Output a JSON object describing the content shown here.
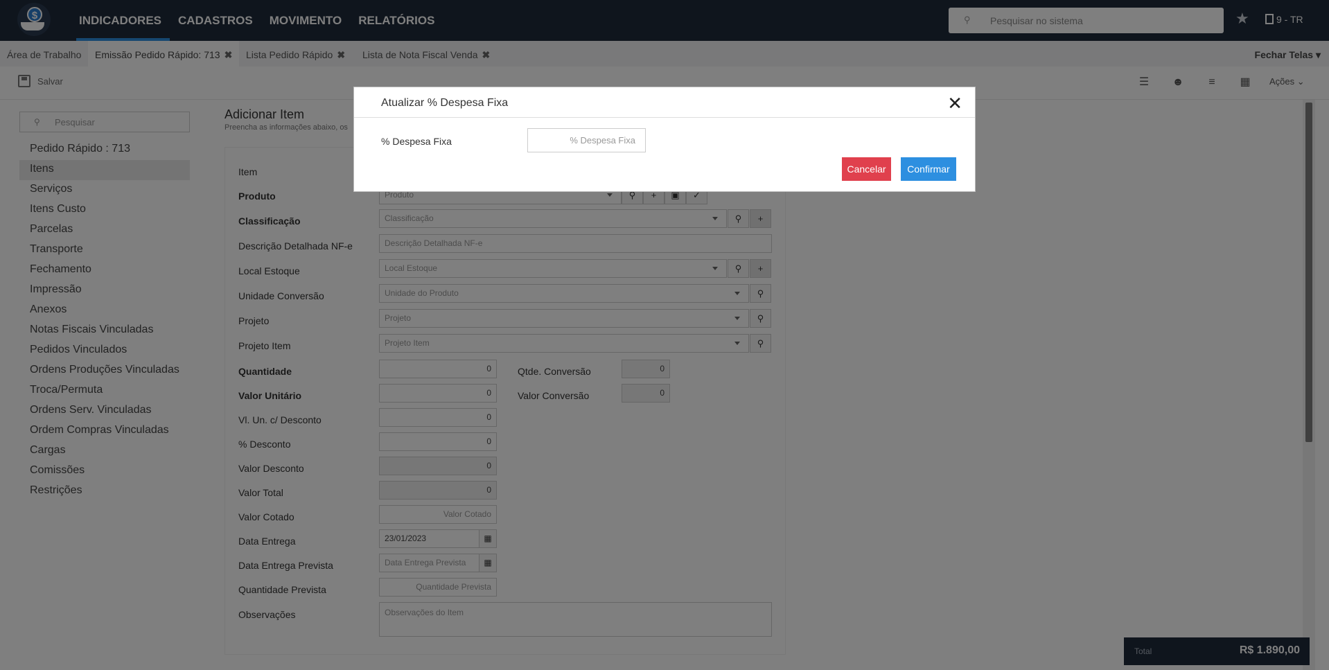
{
  "header": {
    "nav": [
      "INDICADORES",
      "CADASTROS",
      "MOVIMENTO",
      "RELATÓRIOS"
    ],
    "search_placeholder": "Pesquisar no sistema",
    "company": "9 - TR",
    "icons": {
      "logo": "dollar-hand-icon",
      "search": "search-icon",
      "star": "star-icon",
      "company": "building-icon"
    }
  },
  "tabs": [
    {
      "label": "Área de Trabalho",
      "closable": false
    },
    {
      "label": "Emissão Pedido Rápido: 713",
      "closable": true,
      "active": true
    },
    {
      "label": "Lista Pedido Rápido",
      "closable": true
    },
    {
      "label": "Lista de Nota Fiscal Venda",
      "closable": true
    }
  ],
  "tabs_close_all": "Fechar Telas",
  "toolbar": {
    "save_label": "Salvar",
    "actions_label": "Ações"
  },
  "sidebar": {
    "search_placeholder": "Pesquisar",
    "items": [
      "Pedido Rápido : 713",
      "Itens",
      "Serviços",
      "Itens Custo",
      "Parcelas",
      "Transporte",
      "Fechamento",
      "Impressão",
      "Anexos",
      "Notas Fiscais Vinculadas",
      "Pedidos Vinculados",
      "Ordens Produções Vinculadas",
      "Troca/Permuta",
      "Ordens Serv. Vinculadas",
      "Ordem Compras Vinculadas",
      "Cargas",
      "Comissões",
      "Restrições"
    ],
    "active_index": 1
  },
  "main": {
    "title": "Adicionar Item",
    "subtitle": "Preencha as informações abaixo, os",
    "labels": {
      "item": "Item",
      "produto": "Produto",
      "classificacao": "Classificação",
      "descricao": "Descrição Detalhada NF-e",
      "local_estoque": "Local Estoque",
      "unidade_conversao": "Unidade Conversão",
      "projeto": "Projeto",
      "projeto_item": "Projeto Item",
      "quantidade": "Quantidade",
      "valor_unitario": "Valor Unitário",
      "vl_un_desconto": "Vl. Un. c/ Desconto",
      "pct_desconto": "% Desconto",
      "valor_desconto": "Valor Desconto",
      "valor_total": "Valor Total",
      "valor_cotado": "Valor Cotado",
      "data_entrega": "Data Entrega",
      "data_entrega_prevista": "Data Entrega Prevista",
      "quantidade_prevista": "Quantidade Prevista",
      "observacoes": "Observações",
      "qtde_conversao": "Qtde. Conversão",
      "valor_conversao": "Valor Conversão"
    },
    "placeholders": {
      "produto": "Produto",
      "classificacao": "Classificação",
      "descricao": "Descrição Detalhada NF-e",
      "local_estoque": "Local Estoque",
      "unidade": "Unidade do Produto",
      "projeto": "Projeto",
      "projeto_item": "Projeto Item",
      "valor_cotado": "Valor Cotado",
      "data_entrega_prevista": "Data Entrega Prevista",
      "quantidade_prevista": "Quantidade Prevista",
      "observacoes": "Observações do Item"
    },
    "values": {
      "quantidade": "0",
      "valor_unitario": "0",
      "vl_un_desconto": "0",
      "pct_desconto": "0",
      "valor_desconto": "0",
      "valor_total": "0",
      "qtde_conversao": "0",
      "valor_conversao": "0",
      "data_entrega": "23/01/2023"
    }
  },
  "total": {
    "label": "Total",
    "value": "R$ 1.890,00"
  },
  "modal": {
    "title": "Atualizar % Despesa Fixa",
    "field_label": "% Despesa Fixa",
    "field_placeholder": "% Despesa Fixa",
    "cancel_label": "Cancelar",
    "confirm_label": "Confirmar",
    "cancel_color": "#e0404d",
    "confirm_color": "#2d8fe0"
  }
}
